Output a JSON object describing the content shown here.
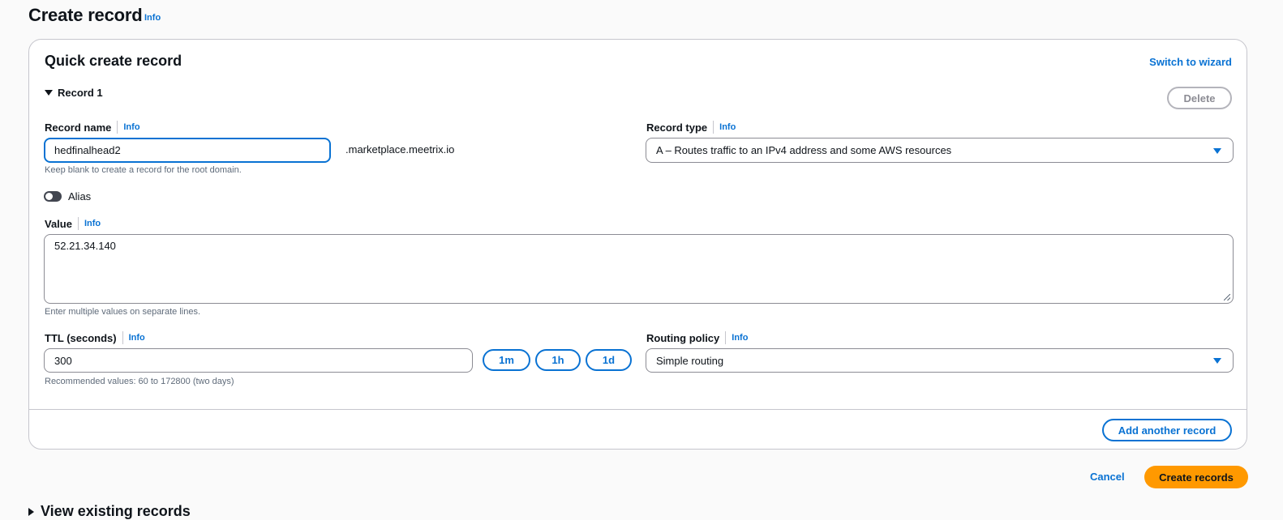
{
  "header": {
    "title": "Create record",
    "info": "Info"
  },
  "card": {
    "title": "Quick create record",
    "switch_link": "Switch to wizard",
    "record_toggle": "Record 1",
    "delete_button": "Delete",
    "record_name": {
      "label": "Record name",
      "info": "Info",
      "value": "hedfinalhead2",
      "suffix": ".marketplace.meetrix.io",
      "hint": "Keep blank to create a record for the root domain."
    },
    "record_type": {
      "label": "Record type",
      "info": "Info",
      "value": "A – Routes traffic to an IPv4 address and some AWS resources"
    },
    "alias": {
      "label": "Alias",
      "enabled": false
    },
    "value_field": {
      "label": "Value",
      "info": "Info",
      "value": "52.21.34.140",
      "hint": "Enter multiple values on separate lines."
    },
    "ttl": {
      "label": "TTL (seconds)",
      "info": "Info",
      "value": "300",
      "hint": "Recommended values: 60 to 172800 (two days)",
      "presets": [
        "1m",
        "1h",
        "1d"
      ]
    },
    "routing_policy": {
      "label": "Routing policy",
      "info": "Info",
      "value": "Simple routing"
    },
    "add_another": "Add another record"
  },
  "footer": {
    "cancel": "Cancel",
    "create": "Create records",
    "view_existing": "View existing records"
  },
  "colors": {
    "link": "#0972d3",
    "primary_button": "#ff9900",
    "text": "#0f141a"
  }
}
